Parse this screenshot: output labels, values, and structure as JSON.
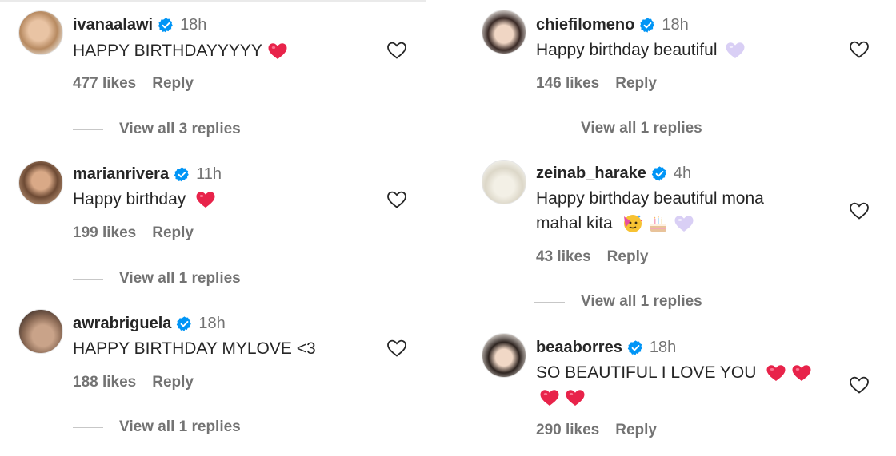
{
  "left_column": {
    "comments": [
      {
        "username": "ivanaalawi",
        "time": "18h",
        "text": "HAPPY BIRTHDAYYYYY",
        "emoji": "red-heart",
        "likes": "477 likes",
        "reply": "Reply",
        "view_replies": "View all 3 replies"
      },
      {
        "username": "marianrivera",
        "time": "11h",
        "text": "Happy birthday",
        "emoji": "red-heart",
        "likes": "199 likes",
        "reply": "Reply",
        "view_replies": "View all 1 replies"
      },
      {
        "username": "awrabriguela",
        "time": "18h",
        "text": "HAPPY BIRTHDAY MYLOVE <3",
        "likes": "188 likes",
        "reply": "Reply",
        "view_replies": "View all 1 replies"
      }
    ]
  },
  "right_column": {
    "comments": [
      {
        "username": "chiefilomeno",
        "time": "18h",
        "text": "Happy birthday beautiful",
        "emoji": "white-heart",
        "likes": "146 likes",
        "reply": "Reply",
        "view_replies": "View all 1 replies"
      },
      {
        "username": "zeinab_harake",
        "time": "4h",
        "text_line1": "Happy birthday beautiful mona",
        "text_line2": "mahal kita",
        "emojis": [
          "partying-face",
          "birthday-cake",
          "white-heart"
        ],
        "likes": "43 likes",
        "reply": "Reply",
        "view_replies": "View all 1 replies"
      },
      {
        "username": "beaaborres",
        "time": "18h",
        "text_line1": "SO BEAUTIFUL I LOVE YOU",
        "emojis": [
          "red-heart",
          "red-heart",
          "red-heart",
          "red-heart"
        ],
        "likes": "290 likes",
        "reply": "Reply"
      }
    ]
  },
  "colors": {
    "verified_blue": "#0095f6",
    "heart_red": "#e8234a",
    "heart_lilac": "#d9cff5",
    "muted_text": "#737373"
  }
}
